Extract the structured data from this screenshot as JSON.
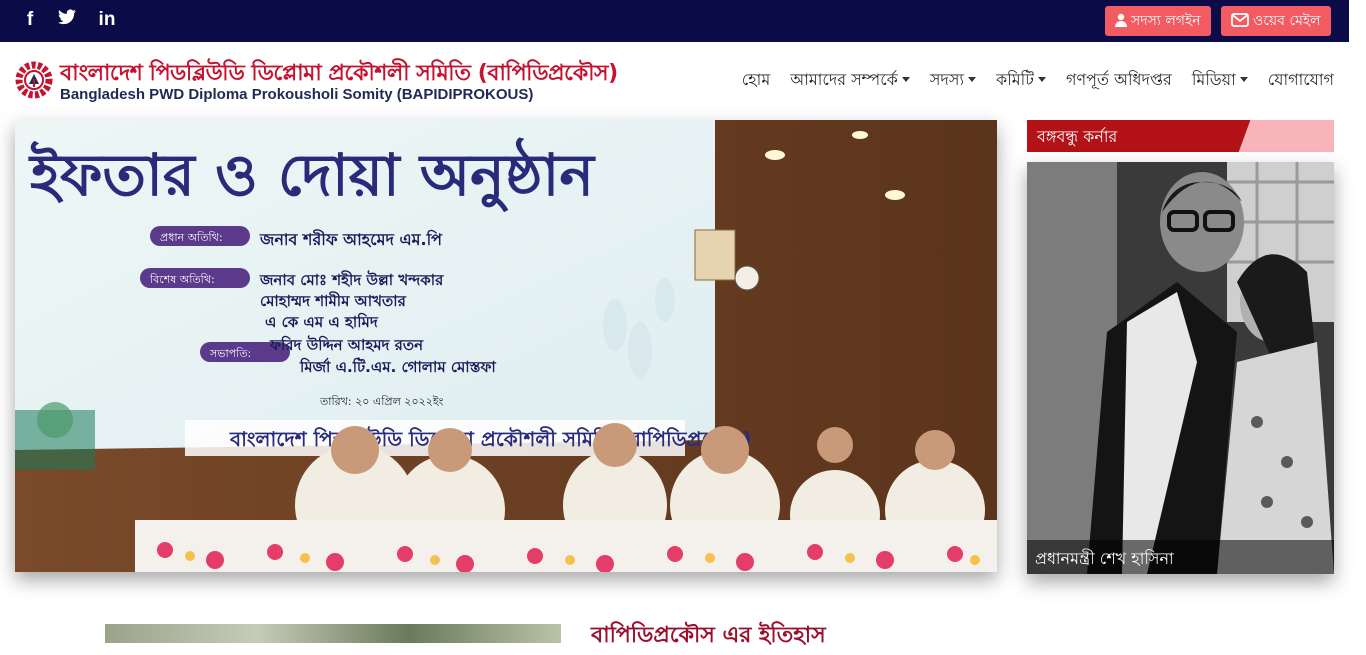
{
  "topbar": {
    "social_icons": [
      "facebook-icon",
      "twitter-icon",
      "linkedin-icon"
    ],
    "member_login_label": "সদস্য লগইন",
    "webmail_label": "ওয়েব মেইল"
  },
  "logo": {
    "title_bn": "বাংলাদেশ পিডব্লিউডি ডিপ্লোমা প্রকৌশলী সমিতি (বাপিডিপ্রকৌস)",
    "title_en": "Bangladesh PWD Diploma Prokousholi Somity (BAPIDIPROKOUS)"
  },
  "nav": {
    "items": [
      {
        "label": "হোম",
        "dropdown": false
      },
      {
        "label": "আমাদের সম্পর্কে",
        "dropdown": true
      },
      {
        "label": "সদস্য",
        "dropdown": true
      },
      {
        "label": "কমিটি",
        "dropdown": true
      },
      {
        "label": "গণপূর্ত অধিদপ্তর",
        "dropdown": false
      },
      {
        "label": "মিডিয়া",
        "dropdown": true
      },
      {
        "label": "যোগাযোগ",
        "dropdown": false
      }
    ]
  },
  "slider": {
    "banner_title": "ইফতার ও দোয়া অনুষ্ঠান",
    "chief_guest_label": "প্রধান অতিথি:",
    "chief_guest_name": "জনাব শরীফ আহমেদ এম.পি",
    "special_guest_label": "বিশেষ অতিথি:",
    "special_guests": [
      "জনাব মোঃ শহীদ উল্লা খন্দকার",
      "মোহাম্মদ শামীম আখতার",
      "এ কে এম এ হামিদ",
      "ফরিদ উদ্দিন আহমদ রতন"
    ],
    "chair_label": "সভাপতি:",
    "chair_name": "মির্জা এ.টি.এম. গোলাম মোস্তফা",
    "date_line": "তারিখ: ২০ এপ্রিল ২০২২ইং",
    "footer_org": "বাংলাদেশ পিডব্লিউডি ডিপ্লোমা প্রকৌশলী সমিতি (বাপিডিপ্রকৌস)"
  },
  "sidebar": {
    "title": "বঙ্গবন্ধু কর্নার",
    "photo_caption": "প্রধানমন্ত্রী শেখ হাসিনা"
  },
  "history": {
    "title": "বাপিডিপ্রকৌস এর ইতিহাস"
  },
  "colors": {
    "topbar": "#0b0b48",
    "accent_button": "#f25b61",
    "brand_red": "#c4122f",
    "section_title": "#9b0f2b"
  }
}
